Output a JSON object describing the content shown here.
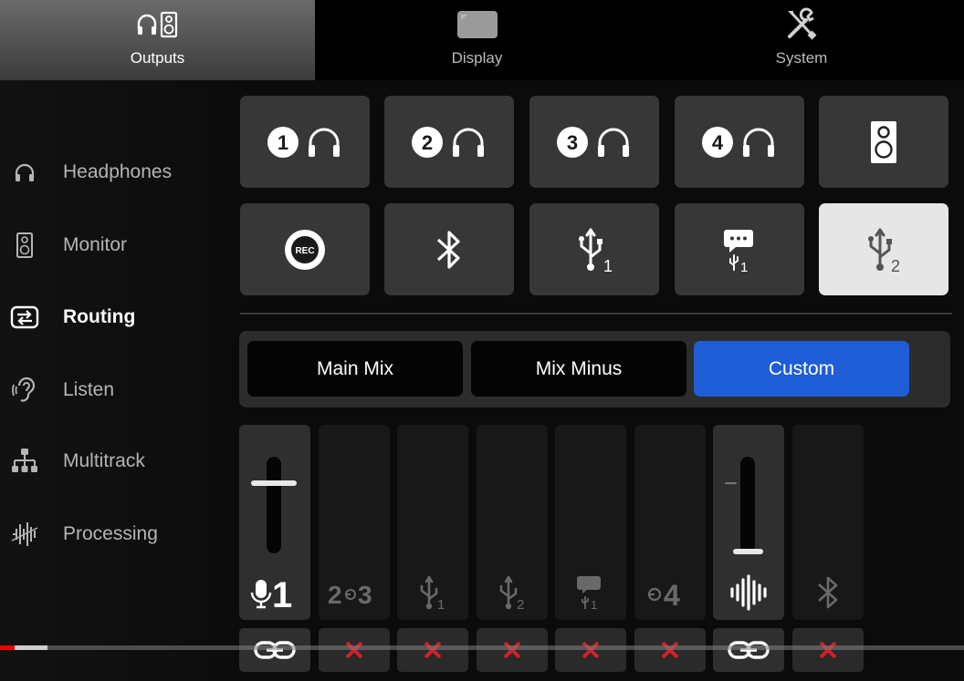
{
  "tabs": [
    {
      "label": "Outputs",
      "icon": "headphones-speaker-icon",
      "active": true
    },
    {
      "label": "Display",
      "icon": "display-icon",
      "active": false
    },
    {
      "label": "System",
      "icon": "tools-icon",
      "active": false
    }
  ],
  "sidebar": {
    "items": [
      {
        "label": "Headphones",
        "icon": "headphones-icon"
      },
      {
        "label": "Monitor",
        "icon": "speaker-icon"
      },
      {
        "label": "Routing",
        "icon": "routing-icon",
        "active": true
      },
      {
        "label": "Listen",
        "icon": "ear-icon"
      },
      {
        "label": "Multitrack",
        "icon": "multitrack-icon"
      },
      {
        "label": "Processing",
        "icon": "processing-icon"
      }
    ]
  },
  "outputs": {
    "row1": [
      {
        "number": "1",
        "icon": "headphones-icon"
      },
      {
        "number": "2",
        "icon": "headphones-icon"
      },
      {
        "number": "3",
        "icon": "headphones-icon"
      },
      {
        "number": "4",
        "icon": "headphones-icon"
      },
      {
        "icon": "speaker-icon"
      }
    ],
    "row2": [
      {
        "icon": "rec-icon",
        "text": "REC"
      },
      {
        "icon": "bluetooth-icon"
      },
      {
        "icon": "usb-icon",
        "sub": "1"
      },
      {
        "icon": "chat-usb-icon",
        "sub": "1"
      },
      {
        "icon": "usb-icon",
        "sub": "2",
        "selected": true
      }
    ]
  },
  "mix_modes": {
    "main_mix": "Main Mix",
    "mix_minus": "Mix Minus",
    "custom": "Custom",
    "active": "Custom"
  },
  "channels": [
    {
      "name": "mic-1",
      "icon": "mic-icon",
      "text": "1",
      "enabled": true,
      "level": 0.72,
      "linked": true
    },
    {
      "name": "inputs-2-3",
      "icon": "input-icon",
      "text": "2",
      "text2": "3",
      "enabled": false,
      "linked": false
    },
    {
      "name": "usb-1",
      "icon": "usb-icon",
      "text": "1",
      "enabled": false,
      "linked": false
    },
    {
      "name": "usb-2",
      "icon": "usb-icon",
      "text": "2",
      "enabled": false,
      "linked": false
    },
    {
      "name": "chat-usb-1",
      "icon": "chat-usb-icon",
      "text": "1",
      "enabled": false,
      "linked": false
    },
    {
      "name": "input-4",
      "icon": "input-icon",
      "text": "4",
      "enabled": false,
      "linked": false
    },
    {
      "name": "sound-pads",
      "icon": "soundwave-icon",
      "enabled": true,
      "level": 0.2,
      "linked": true
    },
    {
      "name": "bluetooth",
      "icon": "bluetooth-icon",
      "enabled": false,
      "linked": false
    }
  ],
  "colors": {
    "accent": "#1f5dd6",
    "mute_x": "#d3202a",
    "video_progress": "#e00000"
  },
  "video_progress": 0.015
}
